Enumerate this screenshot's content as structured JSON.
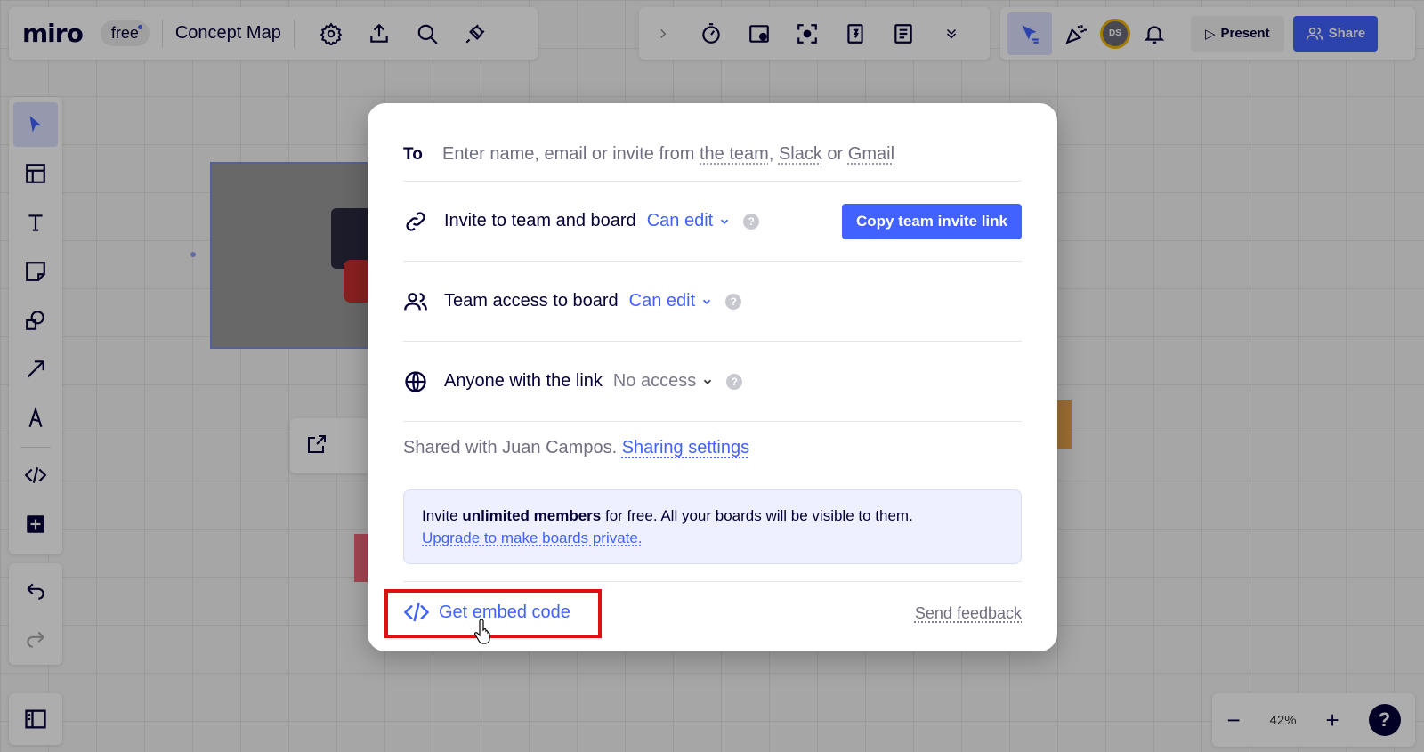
{
  "app": {
    "logo": "miro",
    "plan": "free",
    "board_title": "Concept Map"
  },
  "top_right": {
    "avatar_initials": "DS",
    "present_label": "Present",
    "share_label": "Share"
  },
  "zoom": {
    "level": "42%",
    "help": "?"
  },
  "share_dialog": {
    "to_label": "To",
    "to_placeholder": "Enter name, email or invite from",
    "to_link_team": "the team",
    "to_comma": ",",
    "to_link_slack": "Slack",
    "to_or": "or",
    "to_link_gmail": "Gmail",
    "invite_row": {
      "label": "Invite to team and board",
      "permission": "Can edit",
      "button": "Copy team invite link"
    },
    "team_row": {
      "label": "Team access to board",
      "permission": "Can edit"
    },
    "link_row": {
      "label": "Anyone with the link",
      "permission": "No access"
    },
    "help_glyph": "?",
    "shared_text": "Shared with Juan Campos.",
    "sharing_settings": "Sharing settings",
    "upgrade_box": {
      "pre": "Invite",
      "bold": "unlimited members",
      "post": "for free. All your boards will be visible to them.",
      "link": "Upgrade to make boards private."
    },
    "embed_label": "Get embed code",
    "feedback_label": "Send feedback"
  },
  "colors": {
    "accent": "#4262ff",
    "highlight": "#e01010",
    "text": "#050038"
  }
}
